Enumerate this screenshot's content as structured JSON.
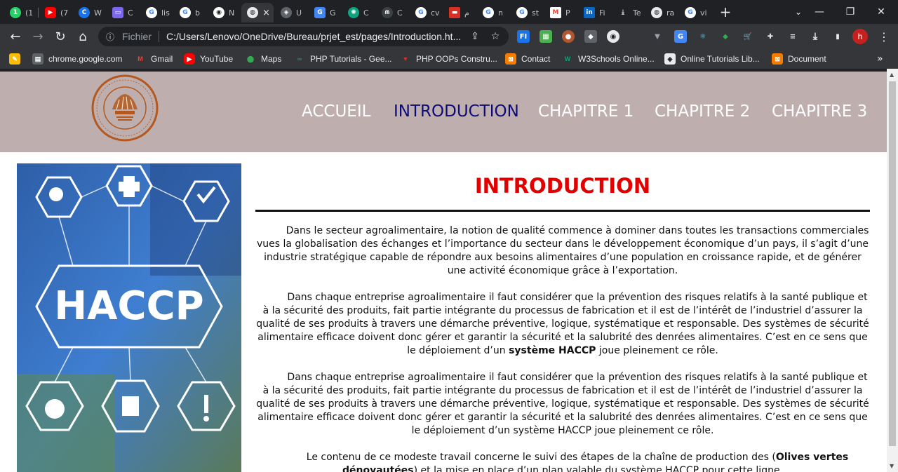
{
  "browser": {
    "tabs": [
      {
        "title": "(1",
        "icon": "whatsapp-icon",
        "color": "#25d366"
      },
      {
        "title": "(7",
        "icon": "youtube-icon",
        "color": "#ff0000"
      },
      {
        "title": "W",
        "icon": "chrome-web-icon",
        "color": "#1a73e8"
      },
      {
        "title": "C",
        "icon": "classroom-icon",
        "color": "#7b68ee"
      },
      {
        "title": "lis",
        "icon": "google-icon",
        "color": "#ffffff"
      },
      {
        "title": "b",
        "icon": "google-icon",
        "color": "#ffffff"
      },
      {
        "title": "N",
        "icon": "github-icon",
        "color": "#ffffff"
      },
      {
        "title": "U",
        "icon": "layers-icon",
        "color": "#9aa0a6"
      },
      {
        "title": "G",
        "icon": "google-translate-icon",
        "color": "#4285f4"
      },
      {
        "title": "C",
        "icon": "chatgpt-icon",
        "color": "#10a37f"
      },
      {
        "title": "C",
        "icon": "site-icon",
        "color": "#9aa0a6"
      },
      {
        "title": "cv",
        "icon": "google-icon",
        "color": "#ffffff"
      },
      {
        "title": "م",
        "icon": "flag-icon",
        "color": "#d93025"
      },
      {
        "title": "n",
        "icon": "google-icon",
        "color": "#ffffff"
      },
      {
        "title": "st",
        "icon": "google-icon",
        "color": "#ffffff"
      },
      {
        "title": "P",
        "icon": "gmail-icon",
        "color": "#ea4335"
      },
      {
        "title": "Fi",
        "icon": "linkedin-icon",
        "color": "#0a66c2"
      },
      {
        "title": "Te",
        "icon": "download-icon",
        "color": "#e8eaed"
      },
      {
        "title": "ra",
        "icon": "globe-icon",
        "color": "#e8eaed"
      },
      {
        "title": "vi",
        "icon": "google-icon",
        "color": "#ffffff"
      }
    ],
    "active_tab_close": "×",
    "new_tab": "+",
    "window_controls": {
      "minimize": "⌄",
      "min": "—",
      "max": "❐",
      "close": "✕"
    },
    "address": {
      "scheme": "Fichier",
      "url": "C:/Users/Lenovo/OneDrive/Bureau/prjet_est/pages/Introduction.ht..."
    },
    "extensions": [
      {
        "label": "FI",
        "color": "#1a73e8"
      },
      {
        "label": "▦",
        "color": "#4caf50"
      },
      {
        "label": "●",
        "color": "#b0572f"
      },
      {
        "label": "◆",
        "color": "#5f6368"
      },
      {
        "label": "◉",
        "color": "#e8eaed"
      },
      {
        "label": "▼",
        "color": "#9aa0a6"
      },
      {
        "label": "G",
        "color": "#4285f4"
      },
      {
        "label": "⚛",
        "color": "#61dafb"
      },
      {
        "label": "◆",
        "color": "#34a853"
      },
      {
        "label": "🛒",
        "color": "#d93025"
      },
      {
        "label": "✚",
        "color": "#e8eaed"
      },
      {
        "label": "≡",
        "color": "#e8eaed"
      },
      {
        "label": "⤓",
        "color": "#e8eaed"
      },
      {
        "label": "▮",
        "color": "#e8eaed"
      }
    ],
    "profile_initial": "h",
    "bookmarks": [
      {
        "label": "",
        "icon": "apps-icon",
        "color": "#fbbc04"
      },
      {
        "label": "chrome.google.com",
        "icon": "chrome-store-icon",
        "color": "#e8eaed"
      },
      {
        "label": "Gmail",
        "icon": "gmail-icon",
        "color": "#ea4335"
      },
      {
        "label": "YouTube",
        "icon": "youtube-icon",
        "color": "#ff0000"
      },
      {
        "label": "Maps",
        "icon": "maps-icon",
        "color": "#34a853"
      },
      {
        "label": "PHP Tutorials - Gee...",
        "icon": "gfg-icon",
        "color": "#2f8d46"
      },
      {
        "label": "PHP OOPs Constru...",
        "icon": "php-icon",
        "color": "#d93025"
      },
      {
        "label": "Contact",
        "icon": "contact-icon",
        "color": "#f57c00"
      },
      {
        "label": "W3Schools Online...",
        "icon": "w3schools-icon",
        "color": "#04aa6d"
      },
      {
        "label": "Online Tutorials Lib...",
        "icon": "tutorials-icon",
        "color": "#e8eaed"
      },
      {
        "label": "Document",
        "icon": "document-icon",
        "color": "#f57c00"
      }
    ],
    "bookmarks_more": "»"
  },
  "site": {
    "nav": [
      {
        "label": "ACCUEIL",
        "active": false
      },
      {
        "label": "INTRODUCTION",
        "active": true
      },
      {
        "label": "CHAPITRE 1",
        "active": false
      },
      {
        "label": "CHAPITRE 2",
        "active": false
      },
      {
        "label": "CHAPITRE 3",
        "active": false
      }
    ],
    "hero_image_text": "HACCP",
    "title": "INTRODUCTION",
    "paragraphs": {
      "p1": "Dans le secteur agroalimentaire, la notion de qualité commence à dominer dans toutes les transactions commerciales vues la globalisation des échanges et l’importance du secteur dans le développement économique d’un pays, il s’agit d’une industrie stratégique capable de répondre aux besoins alimentaires d’une population en croissance rapide, et de générer une activité économique grâce à l’exportation.",
      "p2_main": "Dans chaque entreprise agroalimentaire il faut considérer que la prévention des risques relatifs à la santé publique et à la sécurité des produits, fait partie intégrante du processus de fabrication et il est de l’intérêt de l’industriel d’assurer la qualité de ses produits à travers une démarche préventive, logique, systématique et responsable. Des systèmes de sécurité alimentaire efficace doivent donc gérer et garantir la sécurité et la salubrité des denrées alimentaires. C’est en ce sens que le déploiement d’un",
      "p2_bold": "système HACCP",
      "p2_end": "joue pleinement ce rôle.",
      "p3": "Dans chaque entreprise agroalimentaire il faut considérer que la prévention des risques relatifs à la santé publique et à la sécurité des produits, fait partie intégrante du processus de fabrication et il est de l’intérêt de l’industriel d’assurer la qualité de ses produits à travers une démarche préventive, logique, systématique et responsable. Des systèmes de sécurité alimentaire efficace doivent donc gérer et garantir la sécurité et la salubrité des denrées alimentaires. C’est en ce sens que le déploiement d’un système HACCP joue pleinement ce rôle.",
      "p4_start": "Le contenu de ce modeste travail concerne le suivi des étapes de la chaîne de production des (",
      "p4_bold": "Olives vertes dénoyautées",
      "p4_end": ") et la mise en place d’un plan valable du système HACCP pour cette ligne."
    },
    "colors": {
      "header_bg": "#bfaeae",
      "nav_active": "#0b0b7a",
      "title": "#e00000"
    }
  }
}
